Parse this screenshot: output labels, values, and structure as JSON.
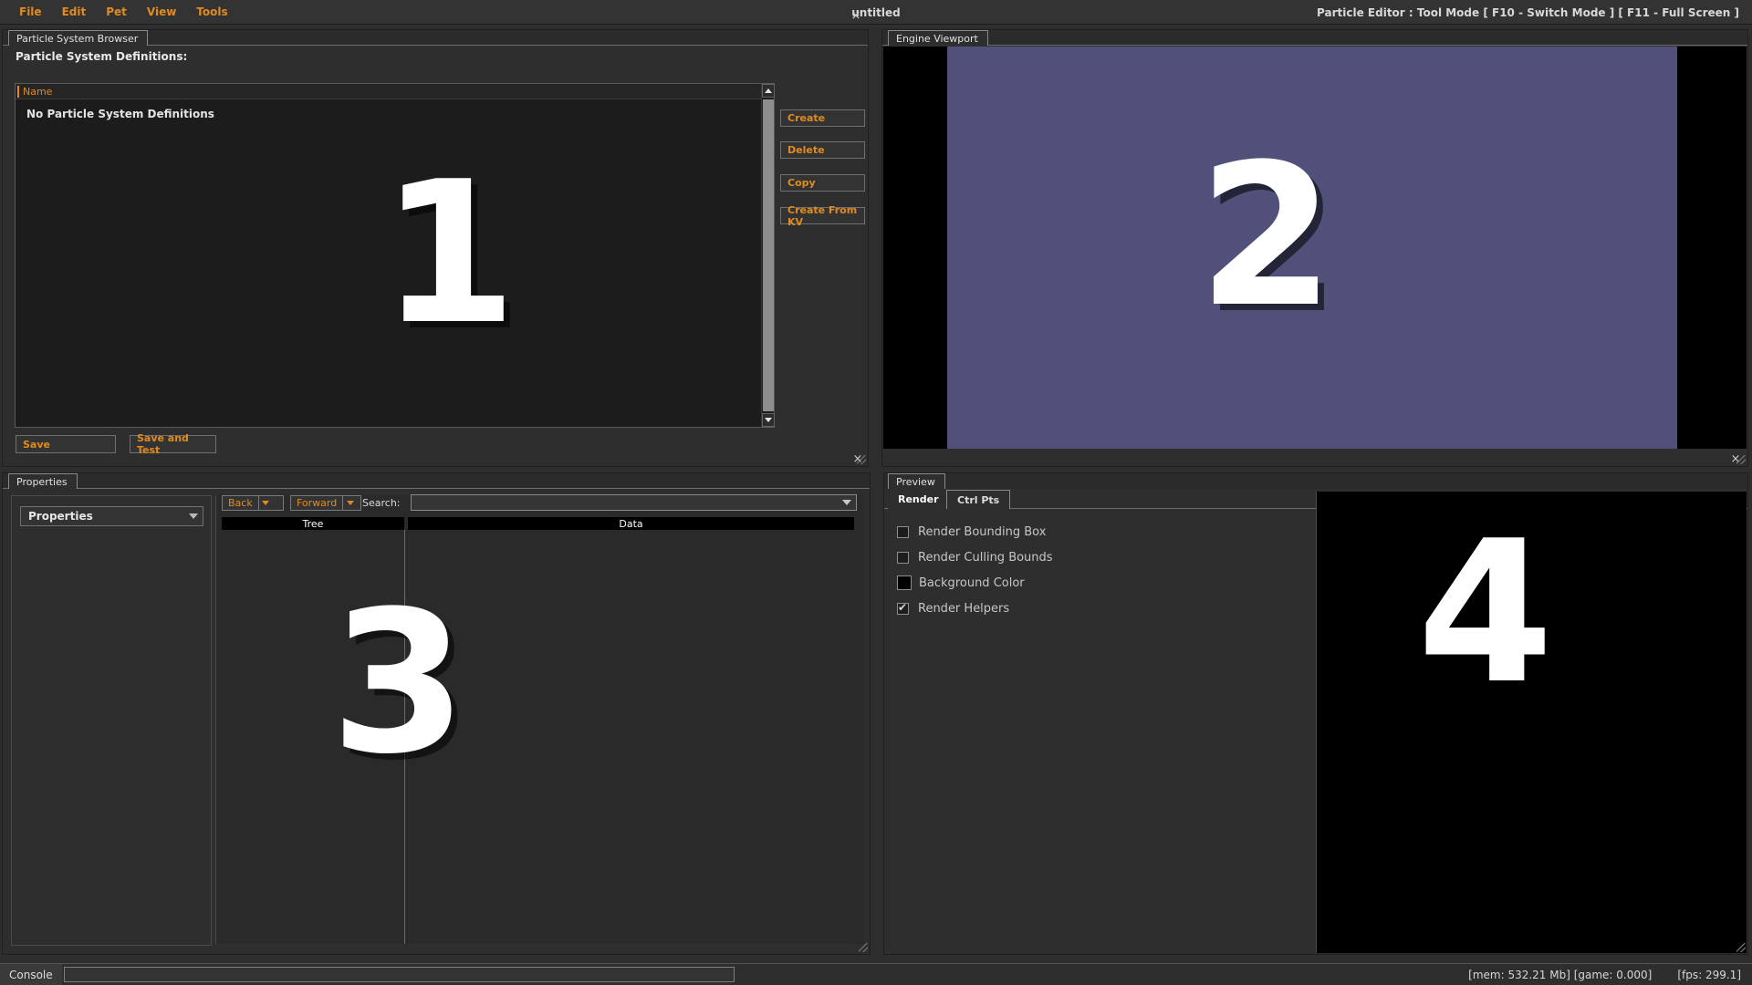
{
  "menubar": {
    "items": [
      {
        "label": "File"
      },
      {
        "label": "Edit"
      },
      {
        "label": "Pet"
      },
      {
        "label": "View"
      },
      {
        "label": "Tools"
      }
    ],
    "window_title": "untitled",
    "mode_label": "Particle Editor  : Tool Mode [ F10 - Switch Mode ] [ F11 - Full Screen ]"
  },
  "browser_panel": {
    "tab_label": "Particle System Browser",
    "close_label": "×",
    "heading": "Particle System Definitions:",
    "column_header": "Name",
    "empty_message": "No Particle System Definitions",
    "overlay_number": "1",
    "buttons": [
      {
        "label": "Create"
      },
      {
        "label": "Delete"
      },
      {
        "label": "Copy"
      },
      {
        "label": "Create From KV"
      }
    ],
    "footer_buttons": [
      {
        "label": "Save"
      },
      {
        "label": "Save and Test"
      }
    ]
  },
  "viewport_panel": {
    "tab_label": "Engine Viewport",
    "overlay_number": "2",
    "scene_color": "#50507a",
    "letterbox_color": "#000000"
  },
  "properties_panel": {
    "tab_label": "Properties",
    "close_label": "×",
    "overlay_number": "3",
    "selector_value": "Properties",
    "nav_back_label": "Back",
    "nav_forward_label": "Forward",
    "search_label": "Search:",
    "search_value": "",
    "columns": [
      {
        "label": "Tree"
      },
      {
        "label": "Data"
      }
    ]
  },
  "preview_panel": {
    "tab_label": "Preview",
    "close_label": "×",
    "overlay_number": "4",
    "subtabs": [
      {
        "label": "Render",
        "active": true
      },
      {
        "label": "Ctrl Pts",
        "active": false
      }
    ],
    "options": [
      {
        "label": "Render Bounding Box",
        "type": "checkbox",
        "checked": false
      },
      {
        "label": "Render Culling Bounds",
        "type": "checkbox",
        "checked": false
      },
      {
        "label": "Background Color",
        "type": "color",
        "value": "#000000"
      },
      {
        "label": "Render Helpers",
        "type": "checkbox",
        "checked": true
      }
    ]
  },
  "statusbar": {
    "console_label": "Console",
    "console_value": "",
    "mem_game": "[mem: 532.21 Mb] [game: 0.000]",
    "fps": "[fps:  299.1]"
  },
  "colors": {
    "accent_orange": "#e08b20",
    "panel_bg": "#2e2e2e",
    "menu_bg": "#333333"
  }
}
